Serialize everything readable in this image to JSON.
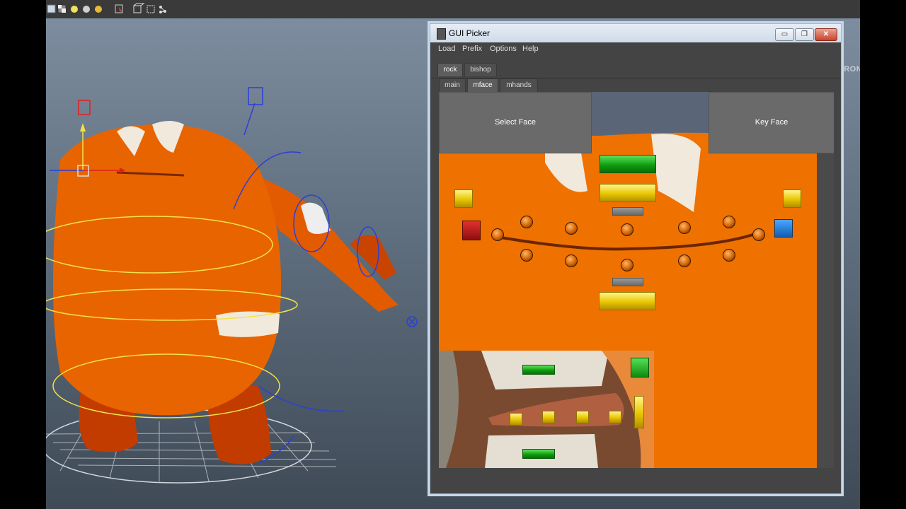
{
  "topbar": {
    "icons": [
      "cube-view-icon",
      "checker-icon",
      "sphere-light-icon",
      "sphere-gray-icon",
      "sphere-yellow-icon",
      "select-mask-icon",
      "box-icon",
      "box-wire-icon",
      "network-icon"
    ]
  },
  "viewport": {
    "view_label": "FRONT"
  },
  "picker": {
    "title": "GUI Picker",
    "window_buttons": {
      "minimize": "▭",
      "maximize": "❐",
      "close": "✕"
    },
    "menu": [
      "Load",
      "Prefix",
      "Options",
      "Help"
    ],
    "character_tabs": [
      {
        "label": "rock",
        "active": true
      },
      {
        "label": "bishop",
        "active": false
      }
    ],
    "section_tabs": [
      {
        "label": "main",
        "active": false
      },
      {
        "label": "mface",
        "active": true
      },
      {
        "label": "mhands",
        "active": false
      }
    ],
    "buttons": {
      "select_face": "Select Face",
      "key_face": "Key Face"
    }
  },
  "colors": {
    "skin_orange": "#ef7100",
    "control_green": "#0a9a0a",
    "control_yellow": "#e8c600",
    "control_red": "#b01515",
    "control_blue": "#1f74d0"
  }
}
